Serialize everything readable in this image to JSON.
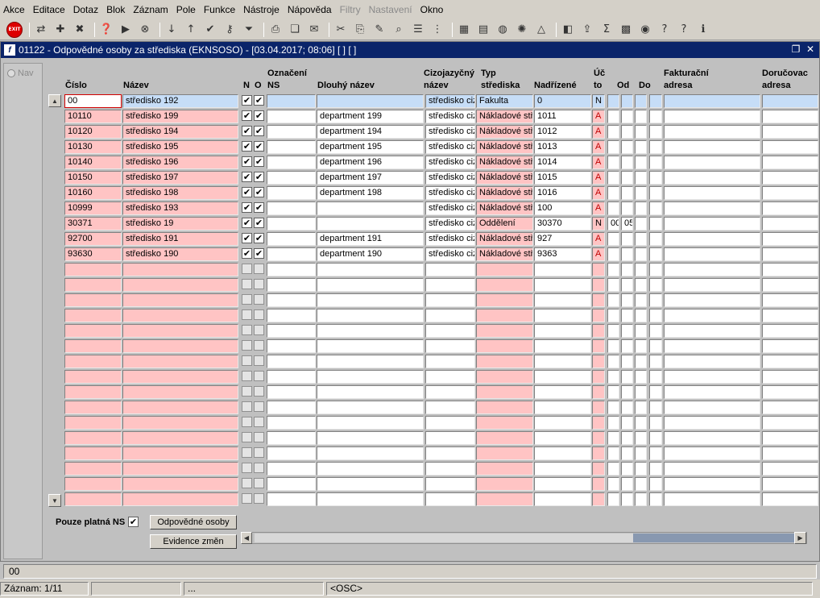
{
  "menu": [
    "Akce",
    "Editace",
    "Dotaz",
    "Blok",
    "Záznam",
    "Pole",
    "Funkce",
    "Nástroje",
    "Nápověda",
    "Filtry",
    "Nastavení",
    "Okno"
  ],
  "menu_disabled": [
    "Filtry",
    "Nastavení"
  ],
  "toolbar": {
    "exit_label": "EXIT",
    "icons": [
      "exit-icon",
      "separator",
      "save-icon",
      "new-record-icon",
      "delete-record-icon",
      "separator",
      "query-icon",
      "execute-query-icon",
      "cancel-query-icon",
      "separator",
      "sort-ascending-icon",
      "sort-descending-icon",
      "check-icon",
      "key-icon",
      "filter-icon",
      "separator",
      "print-icon",
      "copy-icon",
      "mail-icon",
      "separator",
      "cut-icon",
      "paste-icon",
      "edit-icon",
      "find-icon",
      "list-icon",
      "tree-icon",
      "separator",
      "calendar-icon",
      "document-icon",
      "globe-icon",
      "settings-icon",
      "tent-icon",
      "separator",
      "chart-icon",
      "export-icon",
      "sum-icon",
      "excel-icon",
      "web-icon",
      "help-context-icon",
      "help-icon",
      "info-icon"
    ]
  },
  "window": {
    "title": "01122 - Odpovědné osoby za střediska (EKNSOSO) - [03.04.2017; 08:06]  [ ]  [ ]",
    "app_icon": "f"
  },
  "nav": {
    "label": "Nav"
  },
  "columns": {
    "cislo": "Číslo",
    "nazev": "Název",
    "n": "N",
    "o": "O",
    "ozn_1": "Označení",
    "ozn_2": "NS",
    "dlouhy": "Dlouhý název",
    "cizo_1": "Cizojazyčný",
    "cizo_2": "název",
    "typ_1": "Typ",
    "typ_2": "střediska",
    "nadrizene": "Nadřízené",
    "ucto_1": "Úč",
    "ucto_2": "to",
    "od": "Od",
    "do": "Do",
    "fakt_1": "Fakturační",
    "fakt_2": "adresa",
    "doruc_1": "Doručovac",
    "doruc_2": "adresa"
  },
  "rows": [
    {
      "cislo": "00",
      "nazev": "středisko 192",
      "n": true,
      "o": true,
      "dlouhy": "",
      "cizo": "středisko cizí",
      "typ": "Fakulta",
      "nadrizene": "0",
      "ucto": "N",
      "od": "",
      "do": ""
    },
    {
      "cislo": "10110",
      "nazev": "středisko 199",
      "n": true,
      "o": true,
      "dlouhy": "department 199",
      "cizo": "středisko cizí",
      "typ": "Nákladové stř",
      "nadrizene": "1011",
      "ucto": "A",
      "od": "",
      "do": ""
    },
    {
      "cislo": "10120",
      "nazev": "středisko 194",
      "n": true,
      "o": true,
      "dlouhy": "department 194",
      "cizo": "středisko cizí",
      "typ": "Nákladové stř",
      "nadrizene": "1012",
      "ucto": "A",
      "od": "",
      "do": ""
    },
    {
      "cislo": "10130",
      "nazev": "středisko 195",
      "n": true,
      "o": true,
      "dlouhy": "department 195",
      "cizo": "středisko cizí",
      "typ": "Nákladové stř",
      "nadrizene": "1013",
      "ucto": "A",
      "od": "",
      "do": ""
    },
    {
      "cislo": "10140",
      "nazev": "středisko 196",
      "n": true,
      "o": true,
      "dlouhy": "department 196",
      "cizo": "středisko cizí",
      "typ": "Nákladové stř",
      "nadrizene": "1014",
      "ucto": "A",
      "od": "",
      "do": ""
    },
    {
      "cislo": "10150",
      "nazev": "středisko 197",
      "n": true,
      "o": true,
      "dlouhy": "department 197",
      "cizo": "středisko cizí",
      "typ": "Nákladové stř",
      "nadrizene": "1015",
      "ucto": "A",
      "od": "",
      "do": ""
    },
    {
      "cislo": "10160",
      "nazev": "středisko 198",
      "n": true,
      "o": true,
      "dlouhy": "department 198",
      "cizo": "středisko cizí",
      "typ": "Nákladové stř",
      "nadrizene": "1016",
      "ucto": "A",
      "od": "",
      "do": ""
    },
    {
      "cislo": "10999",
      "nazev": "středisko 193",
      "n": true,
      "o": true,
      "dlouhy": "",
      "cizo": "středisko cizí",
      "typ": "Nákladové stř",
      "nadrizene": "100",
      "ucto": "A",
      "od": "",
      "do": ""
    },
    {
      "cislo": "30371",
      "nazev": "středisko 19",
      "n": true,
      "o": true,
      "dlouhy": "",
      "cizo": "středisko cizí",
      "typ": "Oddělení",
      "nadrizene": "30370",
      "ucto": "N",
      "od": "00",
      "do": "05"
    },
    {
      "cislo": "92700",
      "nazev": "středisko 191",
      "n": true,
      "o": true,
      "dlouhy": "department 191",
      "cizo": "středisko cizí",
      "typ": "Nákladové stř",
      "nadrizene": "927",
      "ucto": "A",
      "od": "",
      "do": ""
    },
    {
      "cislo": "93630",
      "nazev": "středisko 190",
      "n": true,
      "o": true,
      "dlouhy": "department 190",
      "cizo": "středisko cizí",
      "typ": "Nákladové stř",
      "nadrizene": "9363",
      "ucto": "A",
      "od": "",
      "do": ""
    }
  ],
  "bottom": {
    "pouze_label": "Pouze platná NS",
    "pouze_checked": true,
    "btn_odpovedne": "Odpovědné osoby",
    "btn_evidence": "Evidence změn"
  },
  "status": {
    "field_value": "00",
    "zaznam": "Záznam: 1/11",
    "seg2": "",
    "seg3": "...",
    "seg4": "",
    "osc": "<OSC>"
  },
  "colors": {
    "pink": "#ffc4c4",
    "blue": "#c6ddf7",
    "title": "#0a246a"
  }
}
